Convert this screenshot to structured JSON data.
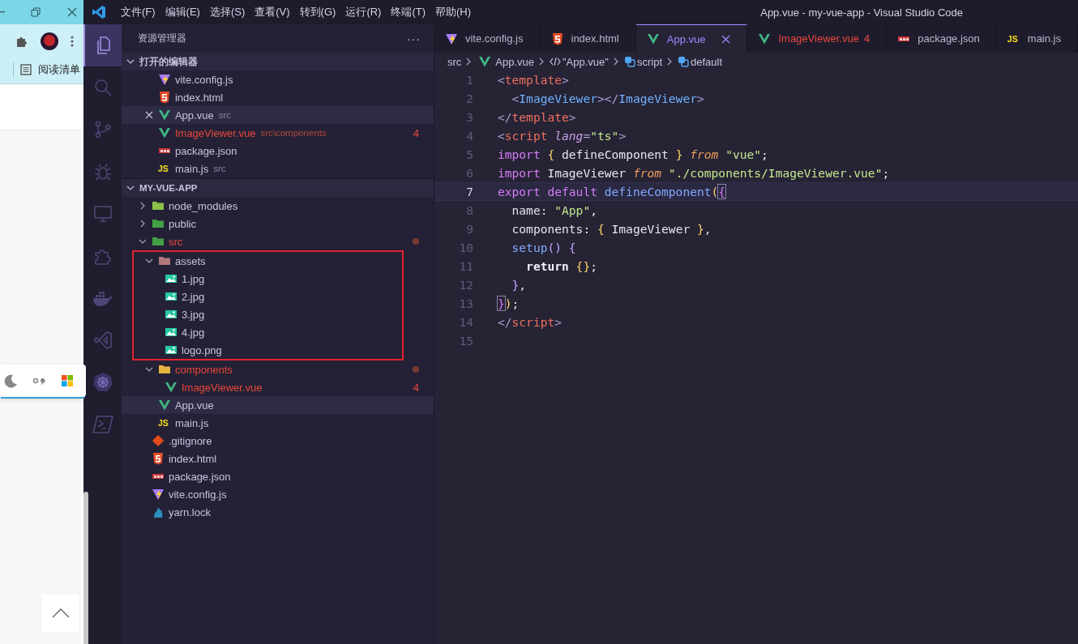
{
  "browser": {
    "reading_list": "阅读清单"
  },
  "window": {
    "title": "App.vue - my-vue-app - Visual Studio Code"
  },
  "menu": [
    "文件(F)",
    "编辑(E)",
    "选择(S)",
    "查看(V)",
    "转到(G)",
    "运行(R)",
    "终端(T)",
    "帮助(H)"
  ],
  "activity_bar": [
    {
      "kind": "files",
      "selected": true
    },
    {
      "kind": "search",
      "selected": false
    },
    {
      "kind": "scm",
      "selected": false
    },
    {
      "kind": "debug",
      "selected": false
    },
    {
      "kind": "remote",
      "selected": false
    },
    {
      "kind": "extensions",
      "selected": false
    },
    {
      "kind": "docker",
      "selected": false
    },
    {
      "kind": "bowtie",
      "selected": false
    },
    {
      "kind": "wheel",
      "selected": false
    },
    {
      "kind": "terminal",
      "selected": false
    }
  ],
  "explorer": {
    "title": "资源管理器",
    "more": "···",
    "open_editors": {
      "title": "打开的编辑器",
      "expanded": true,
      "items": [
        {
          "name": "vite.config.js",
          "kind": "vite",
          "selected": false,
          "error": false
        },
        {
          "name": "index.html",
          "kind": "html",
          "selected": false,
          "error": false
        },
        {
          "name": "App.vue",
          "detail": "src",
          "kind": "vue",
          "selected": true,
          "error": false
        },
        {
          "name": "ImageViewer.vue",
          "detail": "src\\components",
          "kind": "vue",
          "selected": false,
          "error": true,
          "badge": "4"
        },
        {
          "name": "package.json",
          "kind": "npm",
          "selected": false,
          "error": false
        },
        {
          "name": "main.js",
          "detail": "src",
          "kind": "js",
          "icon_text": "JS",
          "selected": false,
          "error": false
        }
      ]
    },
    "project": {
      "title": "MY-VUE-APP",
      "expanded": true
    },
    "tree": [
      {
        "name": "node_modules",
        "kind": "folder-node",
        "expanded": false,
        "selected": false,
        "error": false
      },
      {
        "name": "public",
        "kind": "folder-public",
        "expanded": false,
        "selected": false,
        "error": false
      },
      {
        "name": "src",
        "kind": "folder-src",
        "expanded": true,
        "selected": false,
        "error": true,
        "modified": true,
        "children": [
          {
            "name": "assets",
            "kind": "folder-assets",
            "expanded": true,
            "selected": false,
            "error": false,
            "highlighted": true,
            "children": [
              {
                "name": "1.jpg",
                "kind": "image",
                "selected": false,
                "error": false
              },
              {
                "name": "2.jpg",
                "kind": "image",
                "selected": false,
                "error": false
              },
              {
                "name": "3.jpg",
                "kind": "image",
                "selected": false,
                "error": false
              },
              {
                "name": "4.jpg",
                "kind": "image",
                "selected": false,
                "error": false
              },
              {
                "name": "logo.png",
                "kind": "image",
                "selected": false,
                "error": false
              }
            ]
          },
          {
            "name": "components",
            "kind": "folder-components",
            "expanded": true,
            "selected": false,
            "error": true,
            "modified": true,
            "children": [
              {
                "name": "ImageViewer.vue",
                "kind": "vue",
                "selected": false,
                "error": true,
                "badge": "4"
              }
            ]
          },
          {
            "name": "App.vue",
            "kind": "vue",
            "selected": true,
            "error": false
          },
          {
            "name": "main.js",
            "kind": "js",
            "icon_text": "JS",
            "selected": false,
            "error": false
          }
        ]
      },
      {
        "name": ".gitignore",
        "kind": "git",
        "selected": false,
        "error": false
      },
      {
        "name": "index.html",
        "kind": "html",
        "selected": false,
        "error": false
      },
      {
        "name": "package.json",
        "kind": "npm",
        "selected": false,
        "error": false
      },
      {
        "name": "vite.config.js",
        "kind": "vite",
        "selected": false,
        "error": false
      },
      {
        "name": "yarn.lock",
        "kind": "yarn",
        "selected": false,
        "error": false
      }
    ]
  },
  "tabs": [
    {
      "name": "vite.config.js",
      "kind": "vite",
      "selected": false,
      "error": false
    },
    {
      "name": "index.html",
      "kind": "html",
      "selected": false,
      "error": false
    },
    {
      "name": "App.vue",
      "kind": "vue",
      "selected": true,
      "error": false
    },
    {
      "name": "ImageViewer.vue",
      "kind": "vue",
      "selected": false,
      "error": true,
      "badge": "4"
    },
    {
      "name": "package.json",
      "kind": "npm",
      "selected": false,
      "error": false
    },
    {
      "name": "main.js",
      "kind": "js",
      "icon_text": "JS",
      "selected": false,
      "error": false
    }
  ],
  "breadcrumb": [
    {
      "kind": "plain",
      "text": "src"
    },
    {
      "kind": "vue",
      "text": "App.vue"
    },
    {
      "kind": "code",
      "text": "\"App.vue\""
    },
    {
      "kind": "block",
      "text": "script"
    },
    {
      "kind": "block",
      "text": "default"
    }
  ],
  "code": [
    {
      "number": "1",
      "current": false,
      "tokens": [
        {
          "kind": "punct",
          "text": "<"
        },
        {
          "kind": "tag",
          "text": "template"
        },
        {
          "kind": "punct",
          "text": ">"
        }
      ]
    },
    {
      "number": "2",
      "current": false,
      "tokens": [
        {
          "kind": "punct",
          "text": "  <"
        },
        {
          "kind": "comp",
          "text": "ImageViewer"
        },
        {
          "kind": "punct",
          "text": "></"
        },
        {
          "kind": "comp",
          "text": "ImageViewer"
        },
        {
          "kind": "punct",
          "text": ">"
        }
      ]
    },
    {
      "number": "3",
      "current": false,
      "tokens": [
        {
          "kind": "punct",
          "text": "</"
        },
        {
          "kind": "tag",
          "text": "template"
        },
        {
          "kind": "punct",
          "text": ">"
        }
      ]
    },
    {
      "number": "4",
      "current": false,
      "tokens": [
        {
          "kind": "punct",
          "text": "<"
        },
        {
          "kind": "tag",
          "text": "script "
        },
        {
          "kind": "attr",
          "text": "lang"
        },
        {
          "kind": "punct",
          "text": "="
        },
        {
          "kind": "str",
          "text": "\"ts\""
        },
        {
          "kind": "punct",
          "text": ">"
        }
      ]
    },
    {
      "number": "5",
      "current": false,
      "tokens": [
        {
          "kind": "kw",
          "text": "import "
        },
        {
          "kind": "brace",
          "text": "{"
        },
        {
          "kind": "plain",
          "text": " defineComponent "
        },
        {
          "kind": "brace",
          "text": "} "
        },
        {
          "kind": "from",
          "text": "from "
        },
        {
          "kind": "str",
          "text": "\"vue\""
        },
        {
          "kind": "plain",
          "text": ";"
        }
      ]
    },
    {
      "number": "6",
      "current": false,
      "tokens": [
        {
          "kind": "kw",
          "text": "import"
        },
        {
          "kind": "plain",
          "text": " ImageViewer "
        },
        {
          "kind": "from",
          "text": "from "
        },
        {
          "kind": "str",
          "text": "\"./components/ImageViewer.vue\""
        },
        {
          "kind": "plain",
          "text": ";"
        }
      ]
    },
    {
      "number": "7",
      "current": true,
      "tokens": [
        {
          "kind": "kw",
          "text": "export default "
        },
        {
          "kind": "fn",
          "text": "defineComponent"
        },
        {
          "kind": "brace",
          "text": "("
        },
        {
          "kind": "brace2",
          "text": "{"
        }
      ]
    },
    {
      "number": "8",
      "current": false,
      "tokens": [
        {
          "kind": "plain",
          "text": "  name: "
        },
        {
          "kind": "str",
          "text": "\"App\""
        },
        {
          "kind": "plain",
          "text": ","
        }
      ]
    },
    {
      "number": "9",
      "current": false,
      "tokens": [
        {
          "kind": "plain",
          "text": "  components: "
        },
        {
          "kind": "brace",
          "text": "{"
        },
        {
          "kind": "plain",
          "text": " ImageViewer "
        },
        {
          "kind": "brace",
          "text": "}"
        },
        {
          "kind": "plain",
          "text": ","
        }
      ]
    },
    {
      "number": "10",
      "current": false,
      "tokens": [
        {
          "kind": "fn",
          "text": "  setup"
        },
        {
          "kind": "paren",
          "text": "() {"
        }
      ]
    },
    {
      "number": "11",
      "current": false,
      "tokens": [
        {
          "kind": "ret",
          "text": "    return "
        },
        {
          "kind": "brace",
          "text": "{}"
        },
        {
          "kind": "plain",
          "text": ";"
        }
      ]
    },
    {
      "number": "12",
      "current": false,
      "tokens": [
        {
          "kind": "paren",
          "text": "  }"
        },
        {
          "kind": "plain",
          "text": ","
        }
      ]
    },
    {
      "number": "13",
      "current": false,
      "tokens": [
        {
          "kind": "brace2",
          "text": "}"
        },
        {
          "kind": "brace",
          "text": ")"
        },
        {
          "kind": "plain",
          "text": ";"
        }
      ]
    },
    {
      "number": "14",
      "current": false,
      "tokens": [
        {
          "kind": "punct",
          "text": "</"
        },
        {
          "kind": "tag",
          "text": "script"
        },
        {
          "kind": "punct",
          "text": ">"
        }
      ]
    },
    {
      "number": "15",
      "current": false
    }
  ]
}
